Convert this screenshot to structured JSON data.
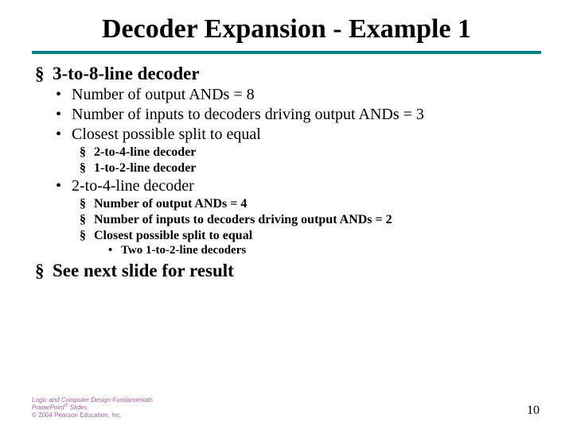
{
  "title": "Decoder Expansion - Example  1",
  "items": [
    {
      "text": "3-to-8-line decoder",
      "sub": [
        {
          "text": "Number of output ANDs = 8"
        },
        {
          "text": "Number of inputs to decoders driving output ANDs = 3"
        },
        {
          "text": "Closest possible split to equal",
          "sub": [
            {
              "text": "2-to-4-line decoder"
            },
            {
              "text": "1-to-2-line decoder"
            }
          ]
        },
        {
          "text": "2-to-4-line decoder",
          "sub": [
            {
              "text": "Number of output ANDs = 4"
            },
            {
              "text": "Number of inputs to decoders driving output ANDs = 2"
            },
            {
              "text": "Closest possible split to equal",
              "sub": [
                {
                  "text": "Two 1-to-2-line decoders"
                }
              ]
            }
          ]
        }
      ]
    },
    {
      "text": "See next slide for result"
    }
  ],
  "footer": {
    "line1a": "Logic and Computer Design Fundamentals",
    "line2a": "PowerPoint",
    "line2b": " Slides",
    "line3": "© 2004 Pearson Education, Inc.",
    "reg": "®"
  },
  "pageNumber": "10"
}
